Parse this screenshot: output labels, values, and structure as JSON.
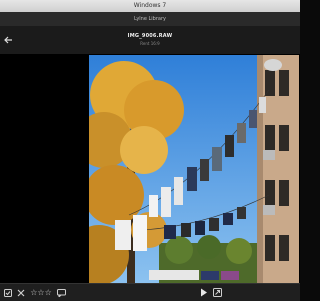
{
  "window": {
    "title": "Windows 7"
  },
  "app": {
    "title": "Lylne Library"
  },
  "header": {
    "file_name": "IMG_9006.RAW",
    "file_info": "Rent 16:9"
  },
  "toolbar": {
    "rating_stars": "☆☆☆"
  },
  "colors": {
    "sky": "#3b8fe0",
    "foliage": "#d9a030",
    "chrome": "#1b1b1b"
  },
  "icons": [
    "back-arrow-icon",
    "accept-icon",
    "reject-icon",
    "comment-icon",
    "play-icon",
    "share-icon"
  ]
}
